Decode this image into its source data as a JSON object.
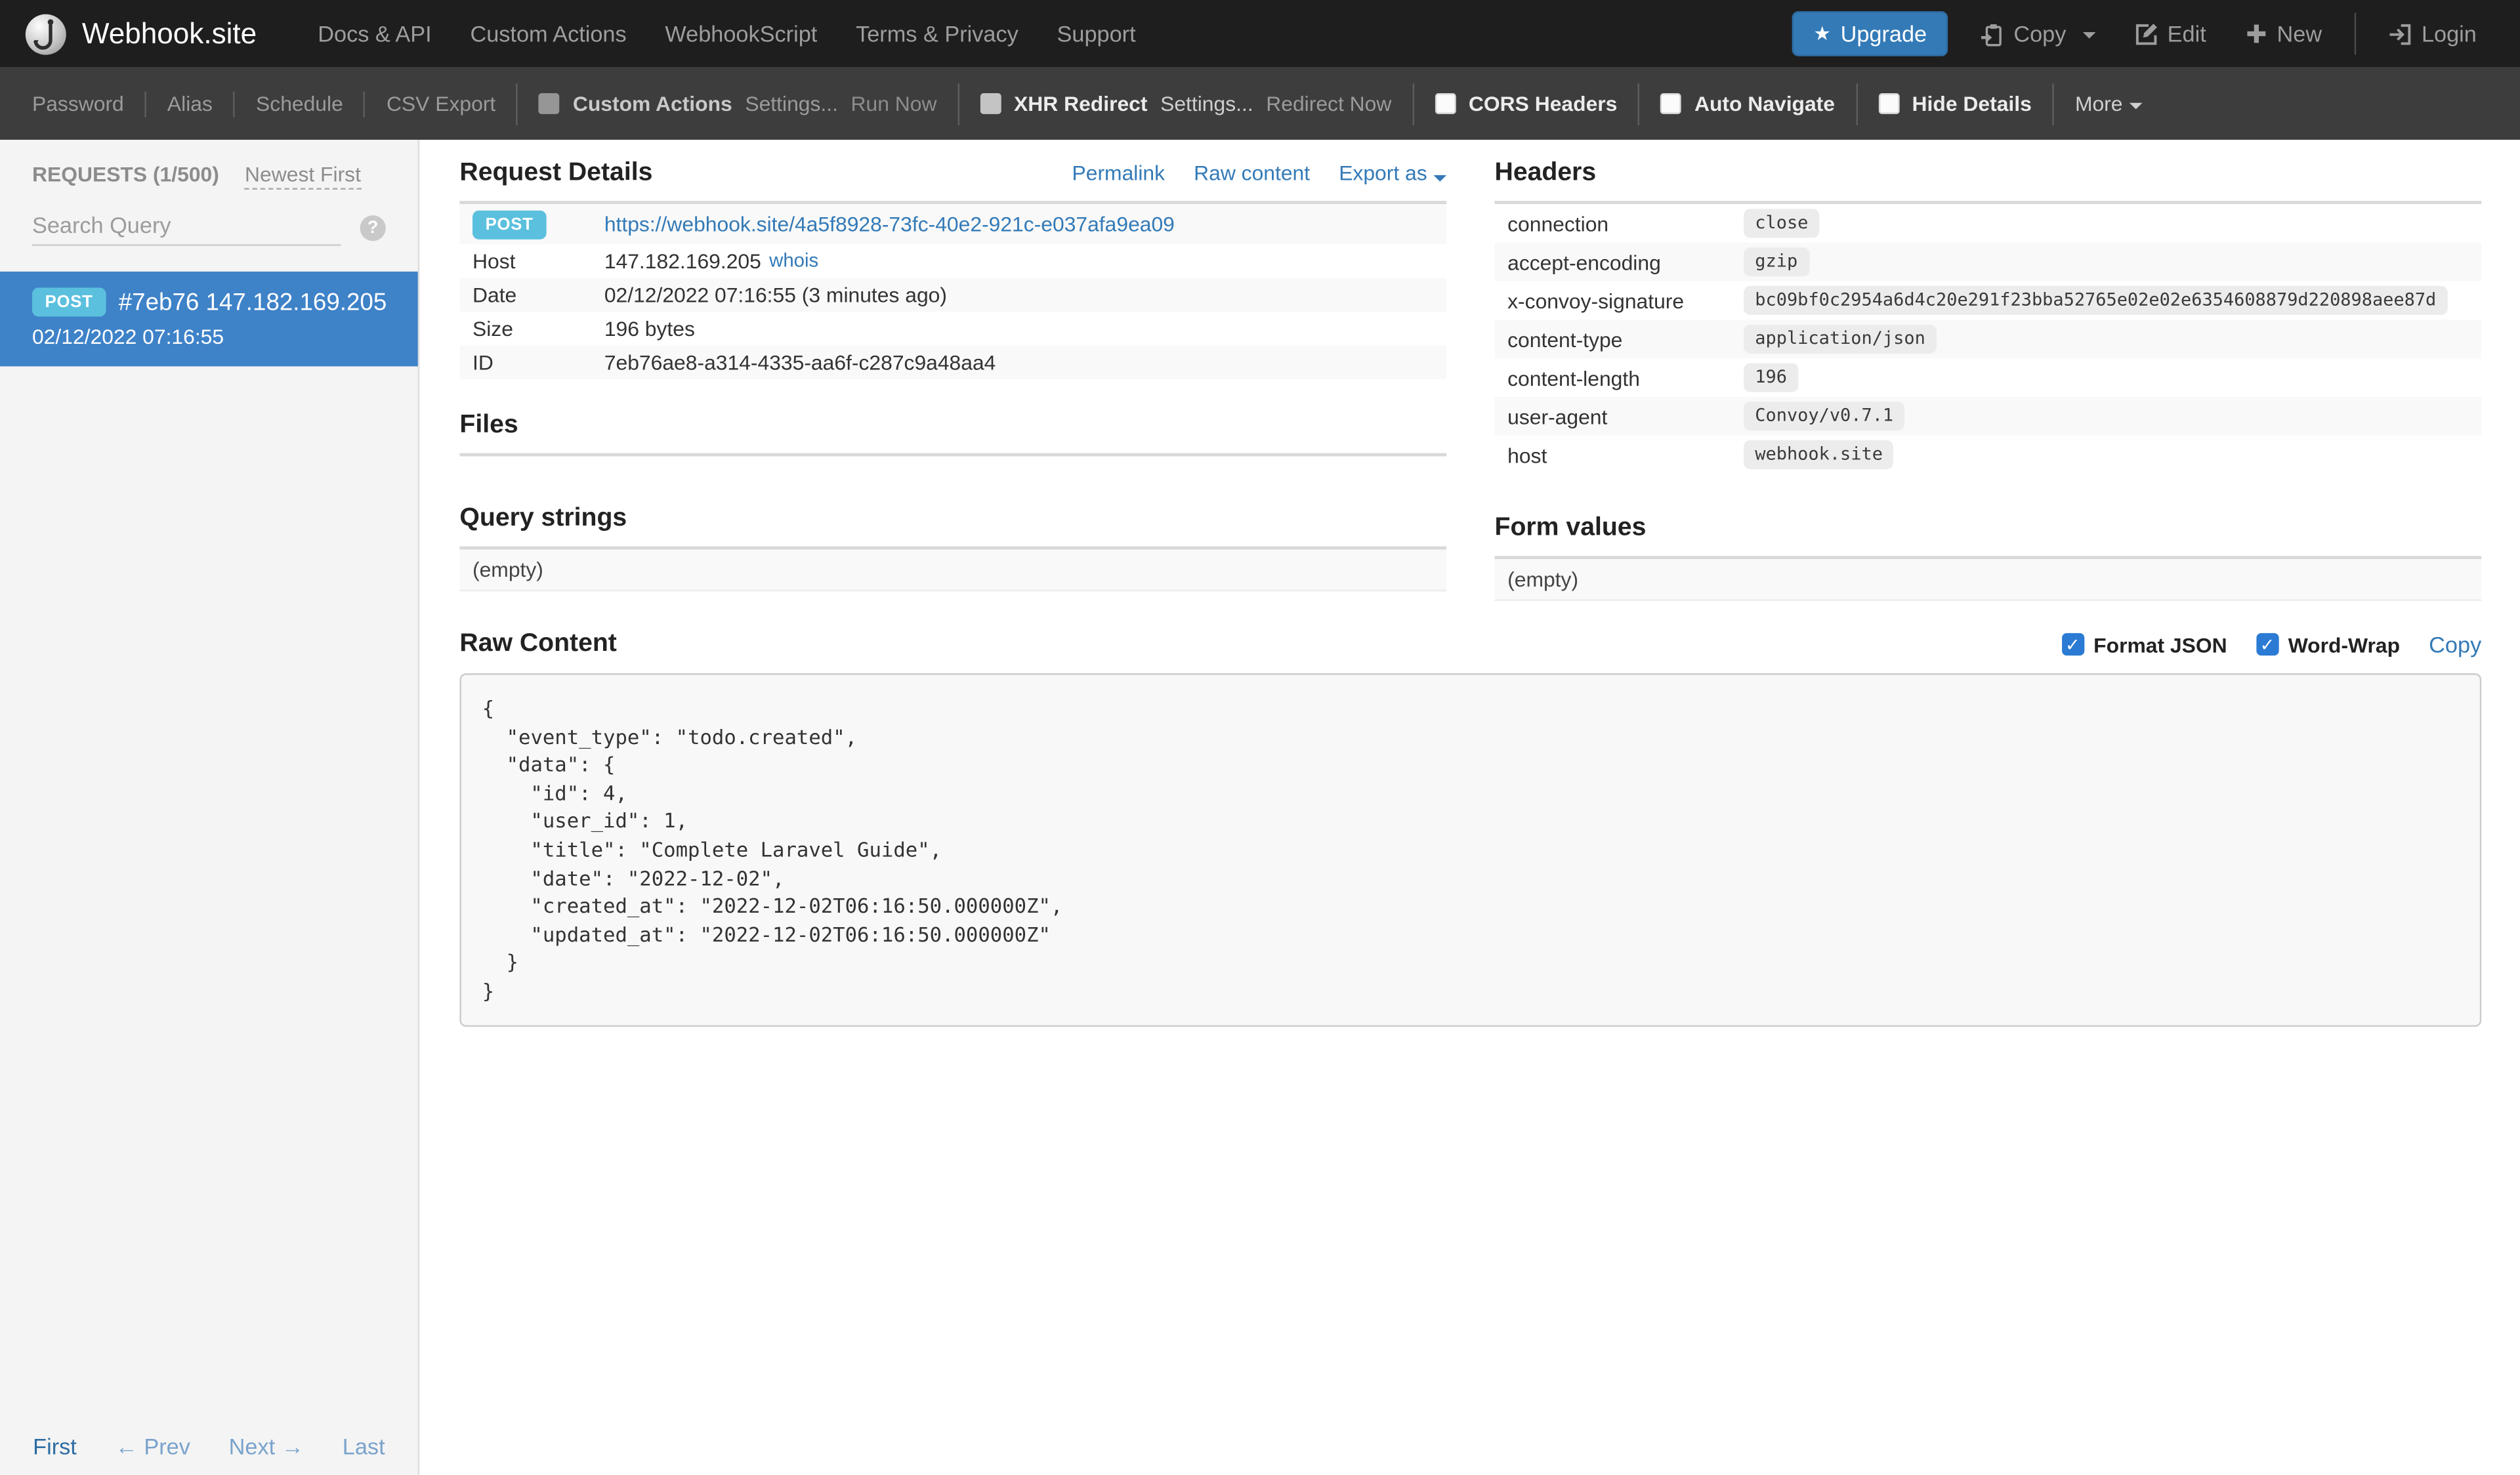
{
  "navbar": {
    "brand": "Webhook.site",
    "links": [
      "Docs & API",
      "Custom Actions",
      "WebhookScript",
      "Terms & Privacy",
      "Support"
    ],
    "upgrade_label": "Upgrade",
    "copy_label": "Copy",
    "edit_label": "Edit",
    "new_label": "New",
    "login_label": "Login"
  },
  "toolbar": {
    "links": [
      "Password",
      "Alias",
      "Schedule",
      "CSV Export"
    ],
    "custom_actions": {
      "label": "Custom Actions",
      "settings": "Settings...",
      "run": "Run Now"
    },
    "xhr_redirect": {
      "label": "XHR Redirect",
      "settings": "Settings...",
      "run": "Redirect Now"
    },
    "toggles": [
      "CORS Headers",
      "Auto Navigate",
      "Hide Details"
    ],
    "more_label": "More"
  },
  "sidebar": {
    "requests_title": "REQUESTS (1/500)",
    "sort_label": "Newest First",
    "search_placeholder": "Search Query",
    "items": [
      {
        "method": "POST",
        "id_ip": "#7eb76 147.182.169.205",
        "timestamp": "02/12/2022 07:16:55"
      }
    ],
    "pagination": {
      "first": "First",
      "prev": "← Prev",
      "next": "Next →",
      "last": "Last"
    }
  },
  "request_details": {
    "title": "Request Details",
    "actions": [
      "Permalink",
      "Raw content",
      "Export as"
    ],
    "method": "POST",
    "url": "https://webhook.site/4a5f8928-73fc-40e2-921c-e037afa9ea09",
    "rows": [
      {
        "label": "Host",
        "value": "147.182.169.205",
        "link": "whois"
      },
      {
        "label": "Date",
        "value": "02/12/2022 07:16:55 (3 minutes ago)"
      },
      {
        "label": "Size",
        "value": "196 bytes"
      },
      {
        "label": "ID",
        "value": "7eb76ae8-a314-4335-aa6f-c287c9a48aa4"
      }
    ],
    "files_title": "Files",
    "query_strings_title": "Query strings",
    "query_strings_empty": "(empty)"
  },
  "headers": {
    "title": "Headers",
    "rows": [
      {
        "name": "connection",
        "value": "close"
      },
      {
        "name": "accept-encoding",
        "value": "gzip"
      },
      {
        "name": "x-convoy-signature",
        "value": "bc09bf0c2954a6d4c20e291f23bba52765e02e02e6354608879d220898aee87d"
      },
      {
        "name": "content-type",
        "value": "application/json"
      },
      {
        "name": "content-length",
        "value": "196"
      },
      {
        "name": "user-agent",
        "value": "Convoy/v0.7.1"
      },
      {
        "name": "host",
        "value": "webhook.site"
      }
    ]
  },
  "form_values": {
    "title": "Form values",
    "empty": "(empty)"
  },
  "raw_content": {
    "title": "Raw Content",
    "format_json_label": "Format JSON",
    "word_wrap_label": "Word-Wrap",
    "copy_label": "Copy",
    "body": "{\n  \"event_type\": \"todo.created\",\n  \"data\": {\n    \"id\": 4,\n    \"user_id\": 1,\n    \"title\": \"Complete Laravel Guide\",\n    \"date\": \"2022-12-02\",\n    \"created_at\": \"2022-12-02T06:16:50.000000Z\",\n    \"updated_at\": \"2022-12-02T06:16:50.000000Z\"\n  }\n}"
  },
  "colors": {
    "accent_blue": "#337ab7",
    "selected_item_blue": "#3e82c8",
    "method_badge_blue": "#5bc0de",
    "checkbox_checked_blue": "#2b7bd4",
    "navbar_bg": "#1e1e1e",
    "toolbar_bg": "#3d3d3d",
    "sidebar_bg": "#f4f4f4"
  }
}
